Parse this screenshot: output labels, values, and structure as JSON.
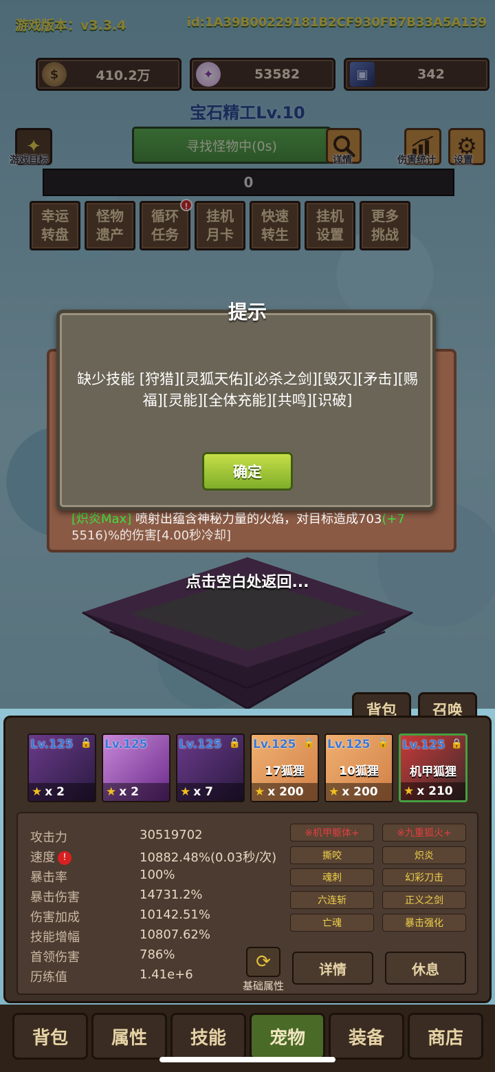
{
  "header": {
    "version": "游戏版本：v3.3.4",
    "player_id": "id:1A39B00229181B2CF930FB7B33A5A139"
  },
  "resources": [
    {
      "icon": "coin-icon",
      "value": "410.2万"
    },
    {
      "icon": "crystal-icon",
      "value": "53582"
    },
    {
      "icon": "card-icon",
      "value": "342"
    }
  ],
  "title": "宝石精工Lv.10",
  "side": {
    "goal_label": "游戏目标",
    "detail_label": "详情",
    "damage_stats_label": "伤害统计",
    "settings_label": "设置"
  },
  "search": {
    "status": "寻找怪物中(0s)"
  },
  "progress": {
    "value": "0"
  },
  "features": [
    {
      "label": "幸运转盘",
      "line1": "幸运",
      "line2": "转盘"
    },
    {
      "label": "怪物遗产",
      "line1": "怪物",
      "line2": "遗产"
    },
    {
      "label": "循环任务",
      "line1": "循环",
      "line2": "任务",
      "badge": "!"
    },
    {
      "label": "挂机月卡",
      "line1": "挂机",
      "line2": "月卡"
    },
    {
      "label": "快速转生",
      "line1": "快速",
      "line2": "转生"
    },
    {
      "label": "挂机设置",
      "line1": "挂机",
      "line2": "设置"
    },
    {
      "label": "更多挑战",
      "line1": "更多",
      "line2": "挑战"
    }
  ],
  "dialog": {
    "title": "提示",
    "message": "缺少技能 [狩猎][灵狐天佑][必杀之剑][毁灭][矛击][赐福][灵能][全体充能][共鸣][识破]",
    "confirm": "确定"
  },
  "skill_preview": {
    "tag": "[炽炎Max]",
    "text": "喷射出蕴含神秘力量的火焰，对目标造成703",
    "bonus": "(+7",
    "line2": "5516)%的伤害[4.00秒冷却]"
  },
  "tap_return": "点击空白处返回...",
  "mini_tabs": {
    "bag": "背包",
    "summon": "召唤"
  },
  "pets": [
    {
      "level": "Lv.125",
      "name": "",
      "count": "x 2",
      "style": "purple"
    },
    {
      "level": "Lv.125",
      "name": "",
      "count": "x 2",
      "style": "pink"
    },
    {
      "level": "Lv.125",
      "name": "",
      "count": "x 7",
      "style": "purple"
    },
    {
      "level": "Lv.125",
      "name": "17狐狸",
      "count": "x 200",
      "style": "orange"
    },
    {
      "level": "Lv.125",
      "name": "10狐狸",
      "count": "x 200",
      "style": "orange"
    },
    {
      "level": "Lv.125",
      "name": "机甲狐狸",
      "count": "x 210",
      "style": "red"
    }
  ],
  "stats": [
    {
      "name": "攻击力",
      "value": "30519702"
    },
    {
      "name": "速度",
      "value": "10882.48%(0.03秒/次)",
      "warn": "!"
    },
    {
      "name": "暴击率",
      "value": "100%"
    },
    {
      "name": "暴击伤害",
      "value": "14731.2%"
    },
    {
      "name": "伤害加成",
      "value": "10142.51%"
    },
    {
      "name": "技能增幅",
      "value": "10807.62%"
    },
    {
      "name": "首领伤害",
      "value": "786%"
    },
    {
      "name": "历练值",
      "value": "1.41e+6"
    }
  ],
  "pet_skills": [
    [
      "※机甲躯体+",
      "※九重狐火+"
    ],
    [
      "撕咬",
      "炽炎"
    ],
    [
      "魂刺",
      "幻彩刀击"
    ],
    [
      "六连斩",
      "正义之剑"
    ],
    [
      "亡魂",
      "暴击强化"
    ]
  ],
  "base_attr_label": "基础属性",
  "actions": {
    "detail": "详情",
    "rest": "休息"
  },
  "nav": [
    "背包",
    "属性",
    "技能",
    "宠物",
    "装备",
    "商店"
  ],
  "nav_active": 3
}
